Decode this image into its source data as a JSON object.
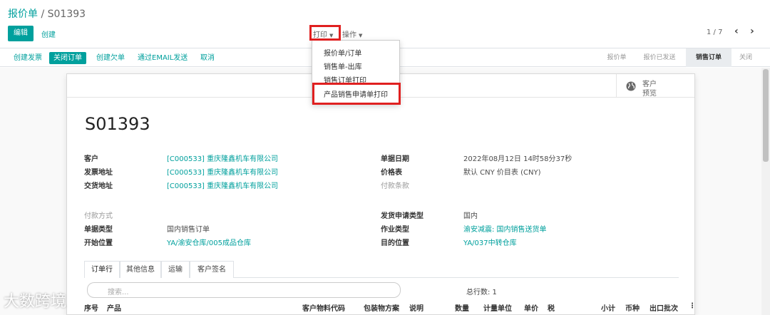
{
  "breadcrumb": {
    "parent": "报价单",
    "separator": "/",
    "current": "S01393"
  },
  "controls": {
    "edit": "编辑",
    "create": "创建",
    "print": "打印",
    "action": "操作",
    "pager": "1 / 7",
    "prev": "‹",
    "next": "›"
  },
  "statusbar": {
    "buttons": [
      "创建发票",
      "关闭订单",
      "创建欠单",
      "通过EMAIL发送",
      "取消"
    ],
    "stages": [
      "报价单",
      "报价已发送",
      "销售订单",
      "关闭"
    ]
  },
  "print_menu": {
    "items": [
      "报价单/订单",
      "销售单-出库",
      "销售订单打印",
      "产品销售申请单打印"
    ]
  },
  "preview": {
    "line1": "客户",
    "line2": "预览"
  },
  "form": {
    "title": "S01393",
    "left": [
      {
        "label": "客户",
        "value": "[C000533] 重庆隆鑫机车有限公司"
      },
      {
        "label": "发票地址",
        "value": "[C000533] 重庆隆鑫机车有限公司"
      },
      {
        "label": "交货地址",
        "value": "[C000533] 重庆隆鑫机车有限公司"
      },
      {
        "label": "付款方式",
        "value": ""
      },
      {
        "label": "单据类型",
        "value": "国内销售订单"
      },
      {
        "label": "开始位置",
        "value": "YA/渝安仓库/005成品仓库"
      }
    ],
    "right": [
      {
        "label": "单据日期",
        "value": "2022年08月12日 14时58分37秒"
      },
      {
        "label": "价格表",
        "value": "默认 CNY 价目表 (CNY)"
      },
      {
        "label": "付款条款",
        "value": ""
      },
      {
        "label": "发货申请类型",
        "value": "国内"
      },
      {
        "label": "作业类型",
        "value": "渝安减震: 国内销售送货单"
      },
      {
        "label": "目的位置",
        "value": "YA/037中转仓库"
      }
    ]
  },
  "tabs": [
    "订单行",
    "其他信息",
    "运输",
    "客户签名"
  ],
  "lines": {
    "search_placeholder": "搜索...",
    "total": "总行数: 1",
    "columns": [
      "序号",
      "产品",
      "客户物料代码",
      "包装物方案",
      "说明",
      "数量",
      "计量单位",
      "单价",
      "税",
      "小计",
      "币种",
      "出口批次"
    ]
  },
  "watermark": "大数跨境",
  "colors": {
    "accent": "#00A09D",
    "highlight": "#e02020"
  }
}
